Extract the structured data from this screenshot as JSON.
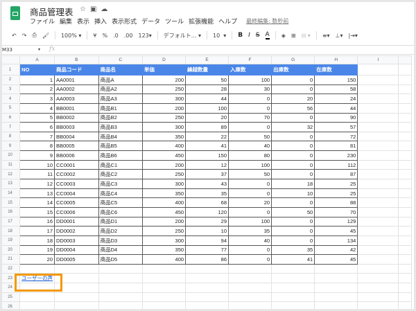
{
  "title": "商品管理表",
  "title_icons": [
    "star-icon",
    "folder-icon",
    "cloud-icon"
  ],
  "menu": [
    "ファイル",
    "編集",
    "表示",
    "挿入",
    "表示形式",
    "データ",
    "ツール",
    "拡張機能",
    "ヘルプ"
  ],
  "last_edit": "最終編集: 数秒前",
  "toolbar": {
    "zoom": "100%",
    "currency": "¥",
    "percent": "%",
    "dec_less": ".0",
    "dec_more": ".00",
    "format": "123▾",
    "font": "デフォルト...",
    "size": "10",
    "bold": "B",
    "italic": "I",
    "strike": "S",
    "textcolor": "A"
  },
  "cell_ref": "M33",
  "fx": "fx",
  "columns": [
    "A",
    "B",
    "C",
    "D",
    "E",
    "F",
    "G",
    "H",
    "I"
  ],
  "headers": [
    "NO",
    "商品コード",
    "商品名",
    "単価",
    "繰越数量",
    "入庫数",
    "出庫数",
    "在庫数"
  ],
  "rows": [
    [
      "1",
      "AA0001",
      "商品A",
      "200",
      "50",
      "100",
      "0",
      "150"
    ],
    [
      "2",
      "AA0002",
      "商品A2",
      "250",
      "28",
      "30",
      "0",
      "58"
    ],
    [
      "3",
      "AA0003",
      "商品A3",
      "300",
      "44",
      "0",
      "20",
      "24"
    ],
    [
      "4",
      "BB0001",
      "商品B1",
      "200",
      "100",
      "0",
      "56",
      "44"
    ],
    [
      "5",
      "BB0002",
      "商品B2",
      "250",
      "20",
      "70",
      "0",
      "90"
    ],
    [
      "6",
      "BB0003",
      "商品B3",
      "300",
      "89",
      "0",
      "32",
      "57"
    ],
    [
      "7",
      "BB0004",
      "商品B4",
      "350",
      "22",
      "50",
      "0",
      "72"
    ],
    [
      "8",
      "BB0005",
      "商品B5",
      "400",
      "41",
      "40",
      "0",
      "81"
    ],
    [
      "9",
      "BB0006",
      "商品B6",
      "450",
      "150",
      "80",
      "0",
      "230"
    ],
    [
      "10",
      "CC0001",
      "商品C1",
      "200",
      "12",
      "100",
      "0",
      "112"
    ],
    [
      "11",
      "CC0002",
      "商品C2",
      "250",
      "37",
      "50",
      "0",
      "87"
    ],
    [
      "12",
      "CC0003",
      "商品C3",
      "300",
      "43",
      "0",
      "18",
      "25"
    ],
    [
      "13",
      "CC0004",
      "商品C4",
      "350",
      "35",
      "0",
      "10",
      "25"
    ],
    [
      "14",
      "CC0005",
      "商品C5",
      "400",
      "68",
      "20",
      "0",
      "88"
    ],
    [
      "15",
      "CC0006",
      "商品C6",
      "450",
      "120",
      "0",
      "50",
      "70"
    ],
    [
      "16",
      "DD0001",
      "商品D1",
      "200",
      "29",
      "100",
      "0",
      "129"
    ],
    [
      "17",
      "DD0002",
      "商品D2",
      "250",
      "10",
      "35",
      "0",
      "45"
    ],
    [
      "18",
      "DD0003",
      "商品D3",
      "300",
      "94",
      "40",
      "0",
      "134"
    ],
    [
      "19",
      "DD0004",
      "商品D4",
      "350",
      "77",
      "0",
      "35",
      "42"
    ],
    [
      "20",
      "DD0005",
      "商品D5",
      "400",
      "86",
      "0",
      "41",
      "45"
    ]
  ],
  "link": "ユーザーの声",
  "highlight_color": "#f39800",
  "header_color": "#4a86e8"
}
